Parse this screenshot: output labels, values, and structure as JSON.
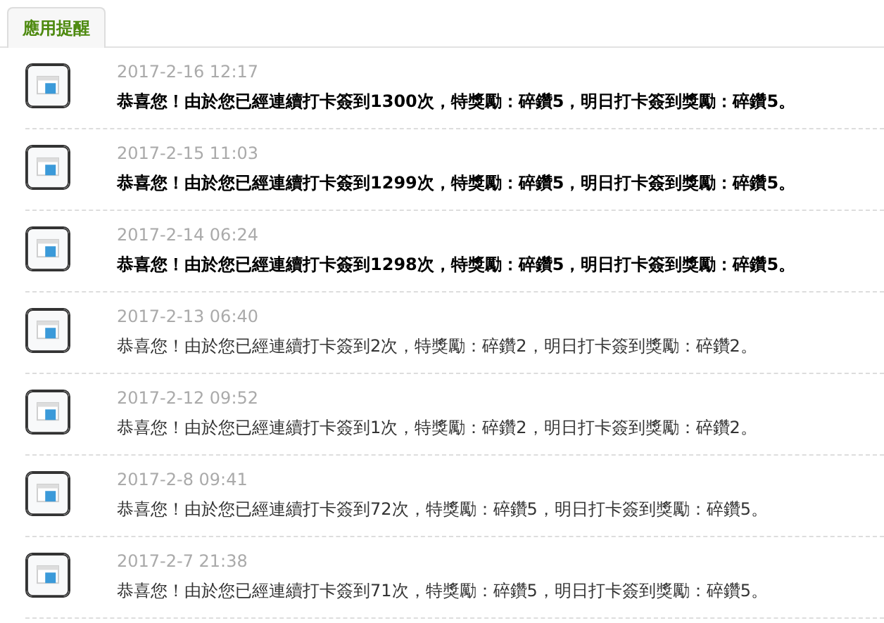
{
  "tabs": [
    {
      "label": "應用提醒",
      "selected": true
    }
  ],
  "notifications": [
    {
      "time": "2017-2-16 12:17",
      "message": "恭喜您！由於您已經連續打卡簽到1300次，特獎勵：碎鑽5，明日打卡簽到獎勵：碎鑽5。",
      "unread": true
    },
    {
      "time": "2017-2-15 11:03",
      "message": "恭喜您！由於您已經連續打卡簽到1299次，特獎勵：碎鑽5，明日打卡簽到獎勵：碎鑽5。",
      "unread": true
    },
    {
      "time": "2017-2-14 06:24",
      "message": "恭喜您！由於您已經連續打卡簽到1298次，特獎勵：碎鑽5，明日打卡簽到獎勵：碎鑽5。",
      "unread": true
    },
    {
      "time": "2017-2-13 06:40",
      "message": "恭喜您！由於您已經連續打卡簽到2次，特獎勵：碎鑽2，明日打卡簽到獎勵：碎鑽2。",
      "unread": false
    },
    {
      "time": "2017-2-12 09:52",
      "message": "恭喜您！由於您已經連續打卡簽到1次，特獎勵：碎鑽2，明日打卡簽到獎勵：碎鑽2。",
      "unread": false
    },
    {
      "time": "2017-2-8 09:41",
      "message": "恭喜您！由於您已經連續打卡簽到72次，特獎勵：碎鑽5，明日打卡簽到獎勵：碎鑽5。",
      "unread": false
    },
    {
      "time": "2017-2-7 21:38",
      "message": "恭喜您！由於您已經連續打卡簽到71次，特獎勵：碎鑽5，明日打卡簽到獎勵：碎鑽5。",
      "unread": false
    }
  ]
}
